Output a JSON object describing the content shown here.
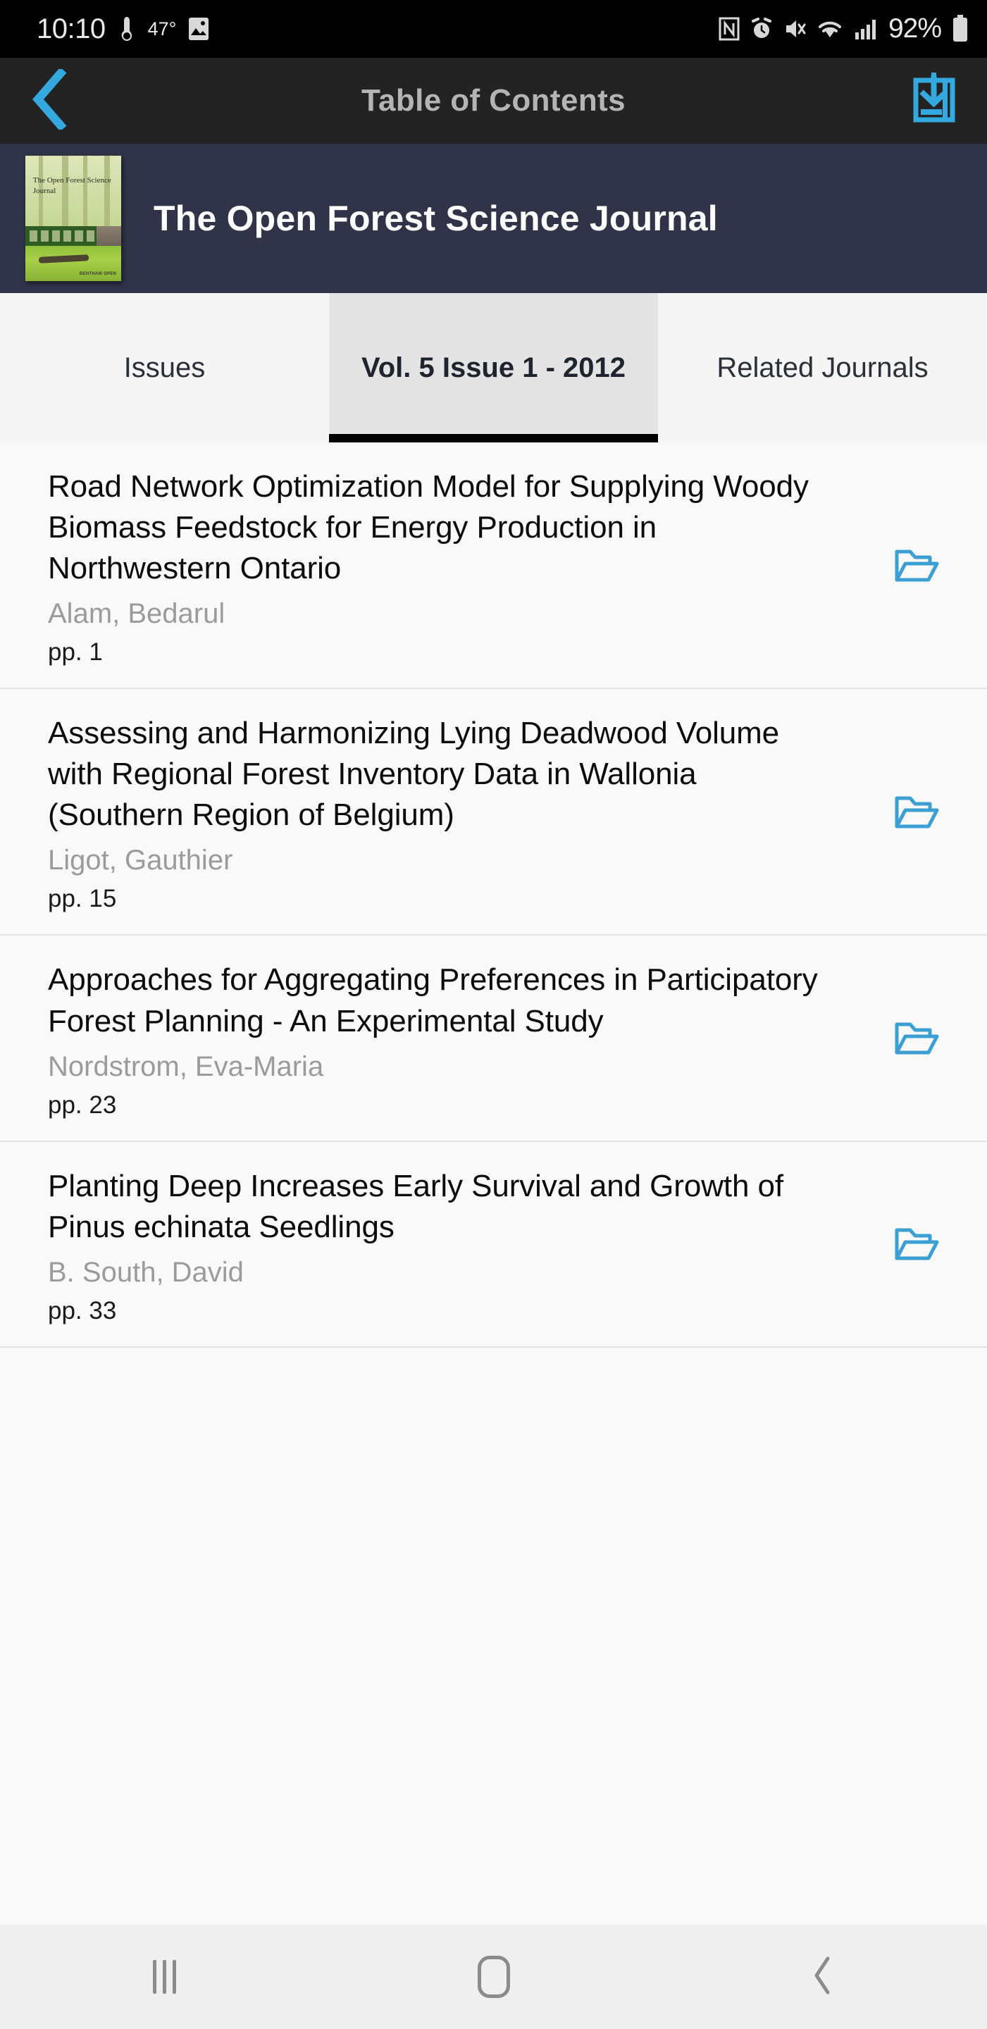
{
  "status_bar": {
    "time": "10:10",
    "temperature": "47°",
    "battery_percent": "92%",
    "left_icons": [
      "weather-thermometer-icon",
      "gallery-image-icon"
    ],
    "right_icons": [
      "nfc-icon",
      "alarm-icon",
      "vibrate-mute-icon",
      "wifi-icon",
      "cellular-signal-icon",
      "battery-icon"
    ]
  },
  "app_bar": {
    "title": "Table of Contents",
    "back_icon": "back-chevron-icon",
    "save_icon": "save-download-icon"
  },
  "journal": {
    "title": "The Open Forest Science Journal",
    "cover_title": "The Open Forest Science Journal",
    "cover_publisher": "BENTHAM OPEN"
  },
  "tabs": [
    {
      "label": "Issues",
      "active": false
    },
    {
      "label": "Vol. 5 Issue 1 - 2012",
      "active": true
    },
    {
      "label": "Related Journals",
      "active": false
    }
  ],
  "articles": [
    {
      "title": "Road Network Optimization Model for Supplying Woody Biomass Feedstock for Energy Production in Northwestern Ontario",
      "author": "Alam, Bedarul",
      "pages": "pp. 1",
      "icon": "open-folder-icon"
    },
    {
      "title": "Assessing and Harmonizing Lying Deadwood Volume with Regional Forest Inventory Data in Wallonia (Southern Region of Belgium)",
      "author": "Ligot, Gauthier",
      "pages": "pp. 15",
      "icon": "open-folder-icon"
    },
    {
      "title": "Approaches for Aggregating Preferences in Participatory Forest Planning - An Experimental Study",
      "author": "Nordstrom, Eva-Maria",
      "pages": "pp. 23",
      "icon": "open-folder-icon"
    },
    {
      "title": "Planting Deep Increases Early Survival and Growth of Pinus echinata Seedlings",
      "author": "B. South, David",
      "pages": "pp. 33",
      "icon": "open-folder-icon"
    }
  ],
  "nav_bar": {
    "recents_label": "recents-icon",
    "home_label": "home-icon",
    "back_label": "back-icon"
  },
  "colors": {
    "accent_blue": "#3b9fd4",
    "app_bar_bg": "#232323",
    "journal_header_bg": "#313448",
    "active_tab_bg": "#e4e4e4",
    "list_bg": "#f9f9f9",
    "author_gray": "#9b9b9b"
  }
}
